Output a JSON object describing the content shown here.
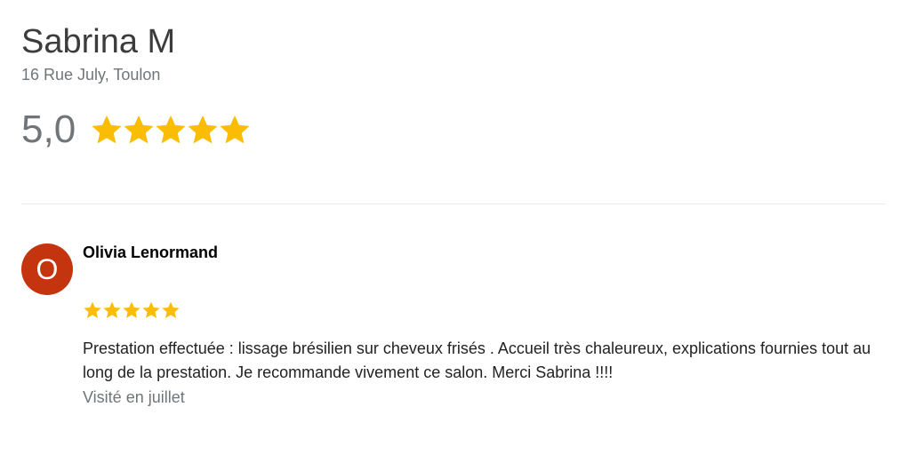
{
  "business": {
    "name": "Sabrina M",
    "address": "16 Rue July, Toulon"
  },
  "rating": {
    "value": "5,0",
    "stars": 5,
    "max_stars": 5
  },
  "review": {
    "avatar_initial": "O",
    "avatar_color": "#c4350f",
    "author": "Olivia Lenormand",
    "stars": 5,
    "max_stars": 5,
    "text": "Prestation effectuée : lissage brésilien sur cheveux frisés . Accueil très chaleureux, explications fournies tout au long de la prestation. Je recommande vivement ce salon. Merci Sabrina !!!!",
    "visit": "Visité en juillet"
  },
  "colors": {
    "star": "#fbbc04",
    "muted_text": "#70757a"
  },
  "icons": {
    "rating_star": "star-icon"
  }
}
